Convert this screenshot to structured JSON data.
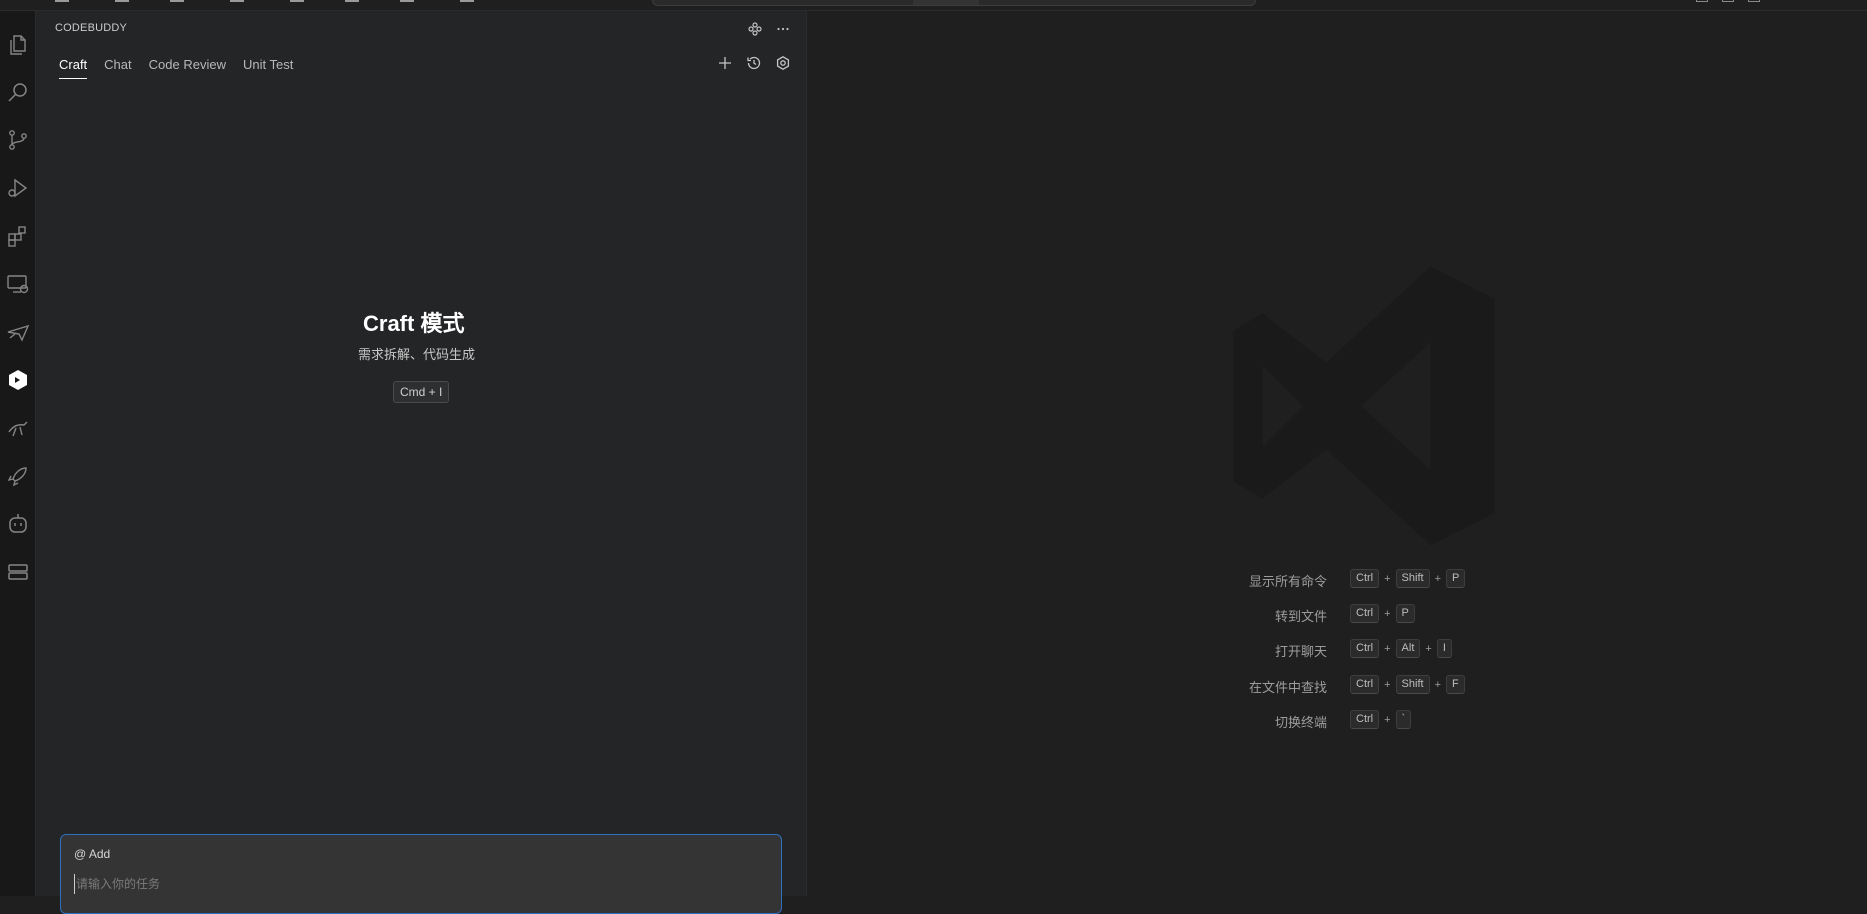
{
  "panel": {
    "title": "CODEBUDDY",
    "tabs": [
      {
        "label": "Craft",
        "active": true
      },
      {
        "label": "Chat",
        "active": false
      },
      {
        "label": "Code Review",
        "active": false
      },
      {
        "label": "Unit Test",
        "active": false
      }
    ]
  },
  "craft": {
    "title": "Craft 模式",
    "subtitle": "需求拆解、代码生成",
    "shortcut": "Cmd + I"
  },
  "input": {
    "add_label": "@ Add",
    "placeholder": "请输入你的任务",
    "value": ""
  },
  "editor": {
    "shortcuts": [
      {
        "label": "显示所有命令",
        "keys": [
          "Ctrl",
          "Shift",
          "P"
        ]
      },
      {
        "label": "转到文件",
        "keys": [
          "Ctrl",
          "P"
        ]
      },
      {
        "label": "打开聊天",
        "keys": [
          "Ctrl",
          "Alt",
          "I"
        ]
      },
      {
        "label": "在文件中查找",
        "keys": [
          "Ctrl",
          "Shift",
          "F"
        ]
      },
      {
        "label": "切换终端",
        "keys": [
          "Ctrl",
          "`"
        ]
      }
    ]
  },
  "activity_icons": [
    "explorer-icon",
    "search-icon",
    "source-control-icon",
    "run-debug-icon",
    "extensions-icon",
    "remote-explorer-icon",
    "plane-icon",
    "codebuddy-icon",
    "kangaroo-icon",
    "rocket-icon",
    "robot-icon",
    "stack-icon"
  ],
  "colors": {
    "accent": "#2f6fbf",
    "editor_bg": "#1f1f1f",
    "sidebar_bg": "#232526"
  }
}
